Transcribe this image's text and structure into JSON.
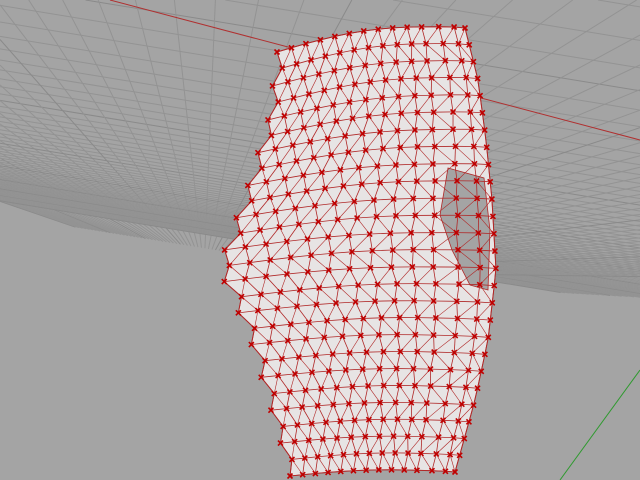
{
  "viewport": {
    "view_type": "perspective",
    "colors": {
      "background": "#a4a4a4",
      "grid_minor": "#939393",
      "grid_major": "#8a8a8a",
      "x_axis": "#b03030",
      "y_axis": "#2f9a2f",
      "mesh_fill": "#e7e4e4",
      "mesh_edge": "#b02828",
      "vertex_marker": "#c00000"
    },
    "mesh": {
      "rows": 26,
      "cols": 13,
      "selected_vertices": "all"
    }
  }
}
